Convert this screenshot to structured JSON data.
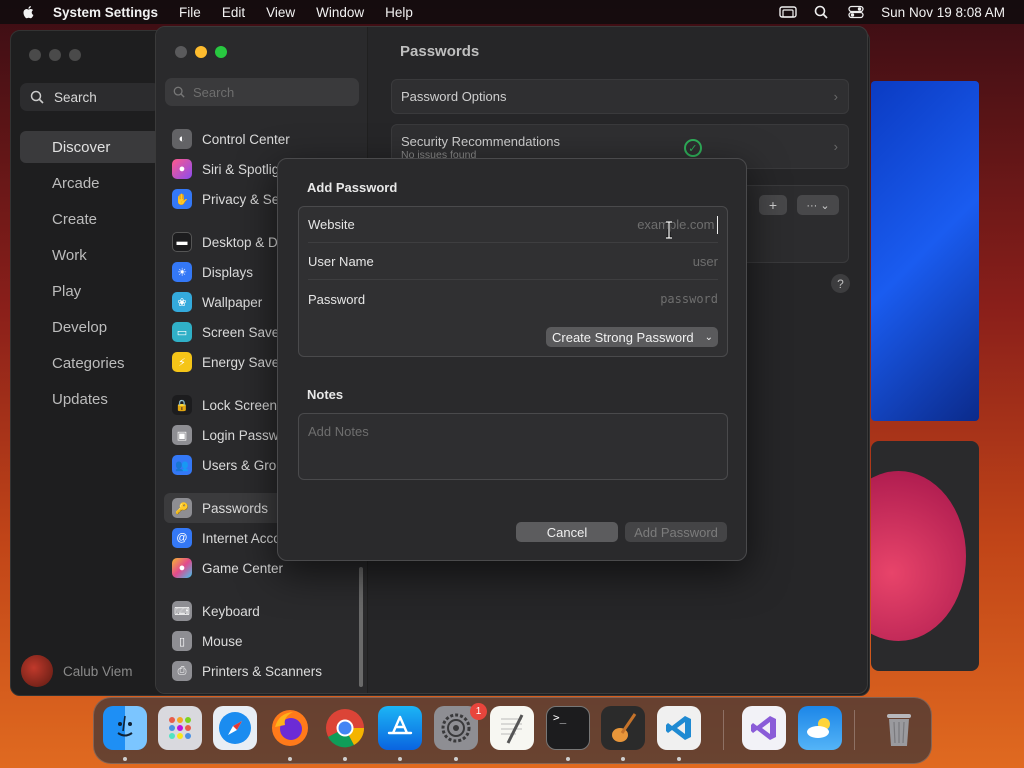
{
  "menubar": {
    "app_name": "System Settings",
    "menus": [
      "File",
      "Edit",
      "View",
      "Window",
      "Help"
    ],
    "clock": "Sun Nov 19  8:08 AM"
  },
  "appstore": {
    "search_label": "Search",
    "nav": [
      "Discover",
      "Arcade",
      "Create",
      "Work",
      "Play",
      "Develop",
      "Categories",
      "Updates"
    ],
    "selected_nav": "Discover",
    "user_name": "Calub Viem"
  },
  "settings": {
    "search_placeholder": "Search",
    "sidebar": [
      {
        "label": "Control Center",
        "icon": "control-center-icon",
        "color": "#636366"
      },
      {
        "label": "Siri & Spotlig",
        "icon": "siri-icon",
        "color": "#c04cd6"
      },
      {
        "label": "Privacy & Sec",
        "icon": "privacy-hand-icon",
        "color": "#3478f6"
      },
      {
        "label": "Desktop & Do",
        "icon": "desktop-dock-icon",
        "color": "#1c1c1e"
      },
      {
        "label": "Displays",
        "icon": "displays-icon",
        "color": "#3478f6"
      },
      {
        "label": "Wallpaper",
        "icon": "wallpaper-icon",
        "color": "#34aadc"
      },
      {
        "label": "Screen Saver",
        "icon": "screen-saver-icon",
        "color": "#30b0c7"
      },
      {
        "label": "Energy Saver",
        "icon": "energy-saver-icon",
        "color": "#f5c518"
      },
      {
        "label": "Lock Screen",
        "icon": "lock-screen-icon",
        "color": "#1c1c1e"
      },
      {
        "label": "Login Passwo",
        "icon": "login-password-icon",
        "color": "#8e8e93"
      },
      {
        "label": "Users & Grou",
        "icon": "users-groups-icon",
        "color": "#3478f6"
      },
      {
        "label": "Passwords",
        "icon": "passwords-key-icon",
        "color": "#8e8e93"
      },
      {
        "label": "Internet Acco",
        "icon": "internet-accounts-icon",
        "color": "#3478f6"
      },
      {
        "label": "Game Center",
        "icon": "game-center-icon",
        "color": "#e24a8d"
      },
      {
        "label": "Keyboard",
        "icon": "keyboard-icon",
        "color": "#8e8e93"
      },
      {
        "label": "Mouse",
        "icon": "mouse-icon",
        "color": "#8e8e93"
      },
      {
        "label": "Printers & Scanners",
        "icon": "printers-icon",
        "color": "#8e8e93"
      }
    ],
    "title": "Passwords",
    "password_options": "Password Options",
    "security_recs": "Security Recommendations",
    "security_recs_sub": "No issues found",
    "add_button": "+",
    "more_button": "··· ⌄",
    "help_button": "?"
  },
  "dialog": {
    "title": "Add Password",
    "website_label": "Website",
    "website_placeholder": "example.com",
    "username_label": "User Name",
    "username_placeholder": "user",
    "password_label": "Password",
    "password_placeholder": "password",
    "strong_password_label": "Create Strong Password",
    "notes_label": "Notes",
    "notes_placeholder": "Add Notes",
    "cancel_label": "Cancel",
    "add_label": "Add Password"
  },
  "dock": {
    "badge_count": "1",
    "apps": [
      "finder-icon",
      "launchpad-icon",
      "safari-icon",
      "firefox-icon",
      "chrome-icon",
      "app-store-icon",
      "system-settings-icon",
      "textedit-icon",
      "terminal-icon",
      "garageband-icon",
      "vscode-icon",
      "visual-studio-icon",
      "weather-icon",
      "trash-icon"
    ]
  }
}
